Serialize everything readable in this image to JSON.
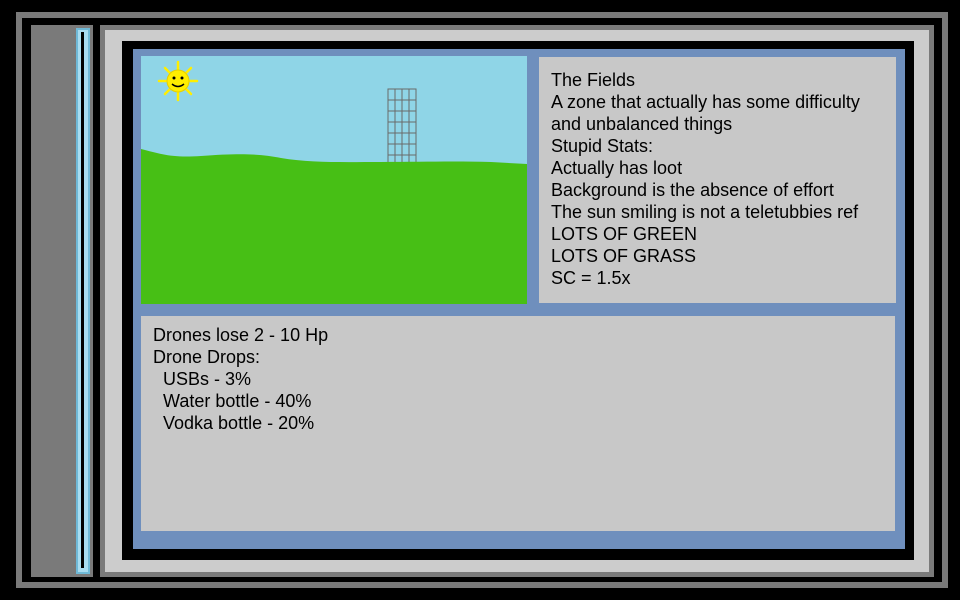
{
  "zone": {
    "title": "The Fields",
    "description_lines": [
      "A zone that actually has some difficulty",
      "and unbalanced things"
    ],
    "stats_heading": "Stupid Stats:",
    "stats": [
      "Actually has loot",
      "Background is the absence of effort",
      "The sun smiling is not a teletubbies ref",
      "LOTS OF GREEN",
      "LOTS OF GRASS",
      "SC = 1.5x"
    ]
  },
  "drones": {
    "hp_text": "Drones lose 2 - 10 Hp",
    "drops_heading": "Drone Drops:",
    "drops": [
      "  USBs - 3%",
      "  Water bottle - 40%",
      "  Vodka bottle - 20%"
    ]
  },
  "colors": {
    "sky": "#8fd5e7",
    "grass": "#47bf15",
    "sun": "#ffee00",
    "frame_blue": "#6f8fbd",
    "panel_gray": "#c8c8c8"
  },
  "scene_icons": [
    "sun-icon",
    "tower-icon",
    "grass-hill"
  ]
}
